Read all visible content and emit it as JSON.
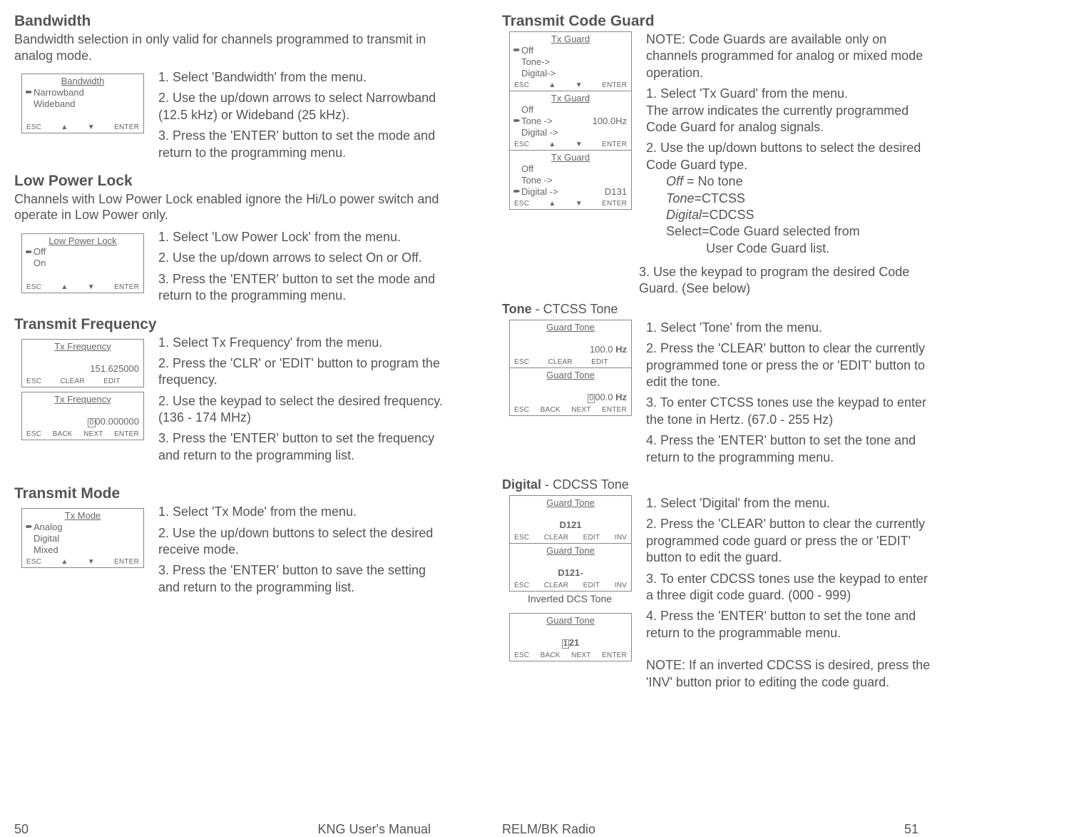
{
  "left": {
    "bandwidth": {
      "heading": "Bandwidth",
      "intro": "Bandwidth selection in only valid for channels programmed to transmit in analog mode.",
      "lcd": {
        "title": "Bandwidth",
        "opt1": "Narrowband",
        "opt2": "Wideband",
        "k1": "ESC",
        "k2": "▲",
        "k3": "▼",
        "k4": "ENTER"
      },
      "s1": "1.   Select 'Bandwidth' from the menu.",
      "s2": "2.   Use the up/down arrows to select Narrowband (12.5 kHz)  or Wideband (25 kHz).",
      "s3": "3.   Press the 'ENTER' button to set the mode and return to the programming menu."
    },
    "lowpower": {
      "heading": "Low Power Lock",
      "intro": "Channels with Low Power Lock enabled ignore the Hi/Lo power switch and operate in Low Power only.",
      "lcd": {
        "title": "Low Power Lock",
        "opt1": "Off",
        "opt2": "On",
        "k1": "ESC",
        "k2": "▲",
        "k3": "▼",
        "k4": "ENTER"
      },
      "s1": "1.    Select 'Low Power Lock' from the menu.",
      "s2": "2.    Use the up/down arrows to select On  or Off.",
      "s3": "3.   Press the 'ENTER' button to set the mode and return to the programming menu."
    },
    "txfreq": {
      "heading": "Transmit Frequency",
      "lcd1": {
        "title": "Tx Frequency",
        "val": "151.625000",
        "k1": "ESC",
        "k2": "CLEAR",
        "k3": "EDIT"
      },
      "lcd2": {
        "title": "Tx Frequency",
        "valprefix": "0",
        "valrest": "00.000000",
        "k1": "ESC",
        "k2": "BACK",
        "k3": "NEXT",
        "k4": "ENTER"
      },
      "s1": "1.   Select Tx Frequency' from the menu.",
      "s2": "2.   Press the 'CLR' or 'EDIT' button to program the frequency.",
      "s3": "2.   Use the keypad to select the desired frequency. (136 - 174 MHz)",
      "s4": "3.   Press the 'ENTER' button to set the frequency and return to the programming list."
    },
    "txmode": {
      "heading": "Transmit Mode",
      "lcd": {
        "title": "Tx Mode",
        "opt1": "Analog",
        "opt2": "Digital",
        "opt3": "Mixed",
        "k1": "ESC",
        "k2": "▲",
        "k3": "▼",
        "k4": "ENTER"
      },
      "s1": "1.   Select 'Tx Mode' from the menu.",
      "s2": "2.   Use the up/down buttons to select the desired receive mode.",
      "s3": "3.   Press the 'ENTER' button to save the setting and return to the programming list."
    },
    "footer": {
      "page": "50",
      "text": "KNG User's Manual"
    }
  },
  "right": {
    "txcode": {
      "heading": "Transmit Code Guard",
      "lcdA": {
        "title": "Tx Guard",
        "l1": "Off",
        "l2": "Tone->",
        "l3": "Digital->",
        "k1": "ESC",
        "k2": "▲",
        "k3": "▼",
        "k4": "ENTER"
      },
      "lcdB": {
        "title": "Tx Guard",
        "l1": "Off",
        "l2": "Tone ->",
        "l2v": "100.0Hz",
        "l3": "Digital ->",
        "k1": "ESC",
        "k2": "▲",
        "k3": "▼",
        "k4": "ENTER"
      },
      "lcdC": {
        "title": "Tx Guard",
        "l1": "Off",
        "l2": "Tone ->",
        "l3": "Digital ->",
        "l3v": "D131",
        "k1": "ESC",
        "k2": "▲",
        "k3": "▼",
        "k4": "ENTER"
      },
      "note": "NOTE: Code Guards are available only on channels programmed for analog or mixed mode operation.",
      "s1": "1.  Select 'Tx Guard' from the menu.",
      "s1b": "The arrow indicates the currently programmed Code Guard for analog signals.",
      "s2": "2.  Use the up/down buttons to select the desired Code Guard type.",
      "t_off": "Off",
      "t_off_eq": " = No tone",
      "t_tone": "Tone",
      "t_tone_eq": "=CTCSS",
      "t_dig": "Digital",
      "t_dig_eq": "=CDCSS",
      "t_sel1": "Select=Code Guard selected from",
      "t_sel2": "User Code Guard list.",
      "s3": "3.  Use the keypad to program the desired Code Guard. (See below)"
    },
    "tone": {
      "heading_pre": "Tone",
      "heading_post": " - CTCSS Tone",
      "lcd1": {
        "title": "Guard Tone",
        "val": "100.0 ",
        "valb": "Hz",
        "k1": "ESC",
        "k2": "CLEAR",
        "k3": "EDIT"
      },
      "lcd2": {
        "title": "Guard Tone",
        "valprefix": "0",
        "valrest": "00.0 ",
        "valb": "Hz",
        "k1": "ESC",
        "k2": "BACK",
        "k3": "NEXT",
        "k4": "ENTER"
      },
      "s1": "1.   Select 'Tone' from the menu.",
      "s2": "2.   Press the 'CLEAR' button to clear the currently programmed tone or press the or 'EDIT' button to edit the tone.",
      "s3": "3.   To enter CTCSS tones use the keypad to enter the tone in Hertz. (67.0 - 255 Hz)",
      "s4": "4.   Press the 'ENTER' button to set the tone and return to the programming menu."
    },
    "digital": {
      "heading_pre": "Digital",
      "heading_post": " - CDCSS Tone",
      "lcd1": {
        "title": "Guard Tone",
        "val": "D121",
        "k1": "ESC",
        "k2": "CLEAR",
        "k3": "EDIT",
        "k4": "INV"
      },
      "lcd2": {
        "title": "Guard Tone",
        "val": "D121-",
        "k1": "ESC",
        "k2": "CLEAR",
        "k3": "EDIT",
        "k4": "INV"
      },
      "sub": "Inverted DCS Tone",
      "lcd3": {
        "title": "Guard Tone",
        "valprefix": "1",
        "valrest": "21",
        "k1": "ESC",
        "k2": "BACK",
        "k3": "NEXT",
        "k4": "ENTER"
      },
      "s1": "1.        Select 'Digital' from the menu.",
      "s2": "2.        Press the 'CLEAR' button to clear the currently programmed code guard or press the or 'EDIT' button to edit the guard.",
      "s3": "3.        To enter CDCSS tones use the keypad to enter a three digit code guard. (000 - 999)",
      "s4": "4.        Press the 'ENTER' button to set the tone and return to the programmable menu.",
      "note": "NOTE: If an inverted CDCSS is desired, press the 'INV' button prior to editing the code guard."
    },
    "footer": {
      "page": "51",
      "text": "RELM/BK Radio"
    }
  }
}
